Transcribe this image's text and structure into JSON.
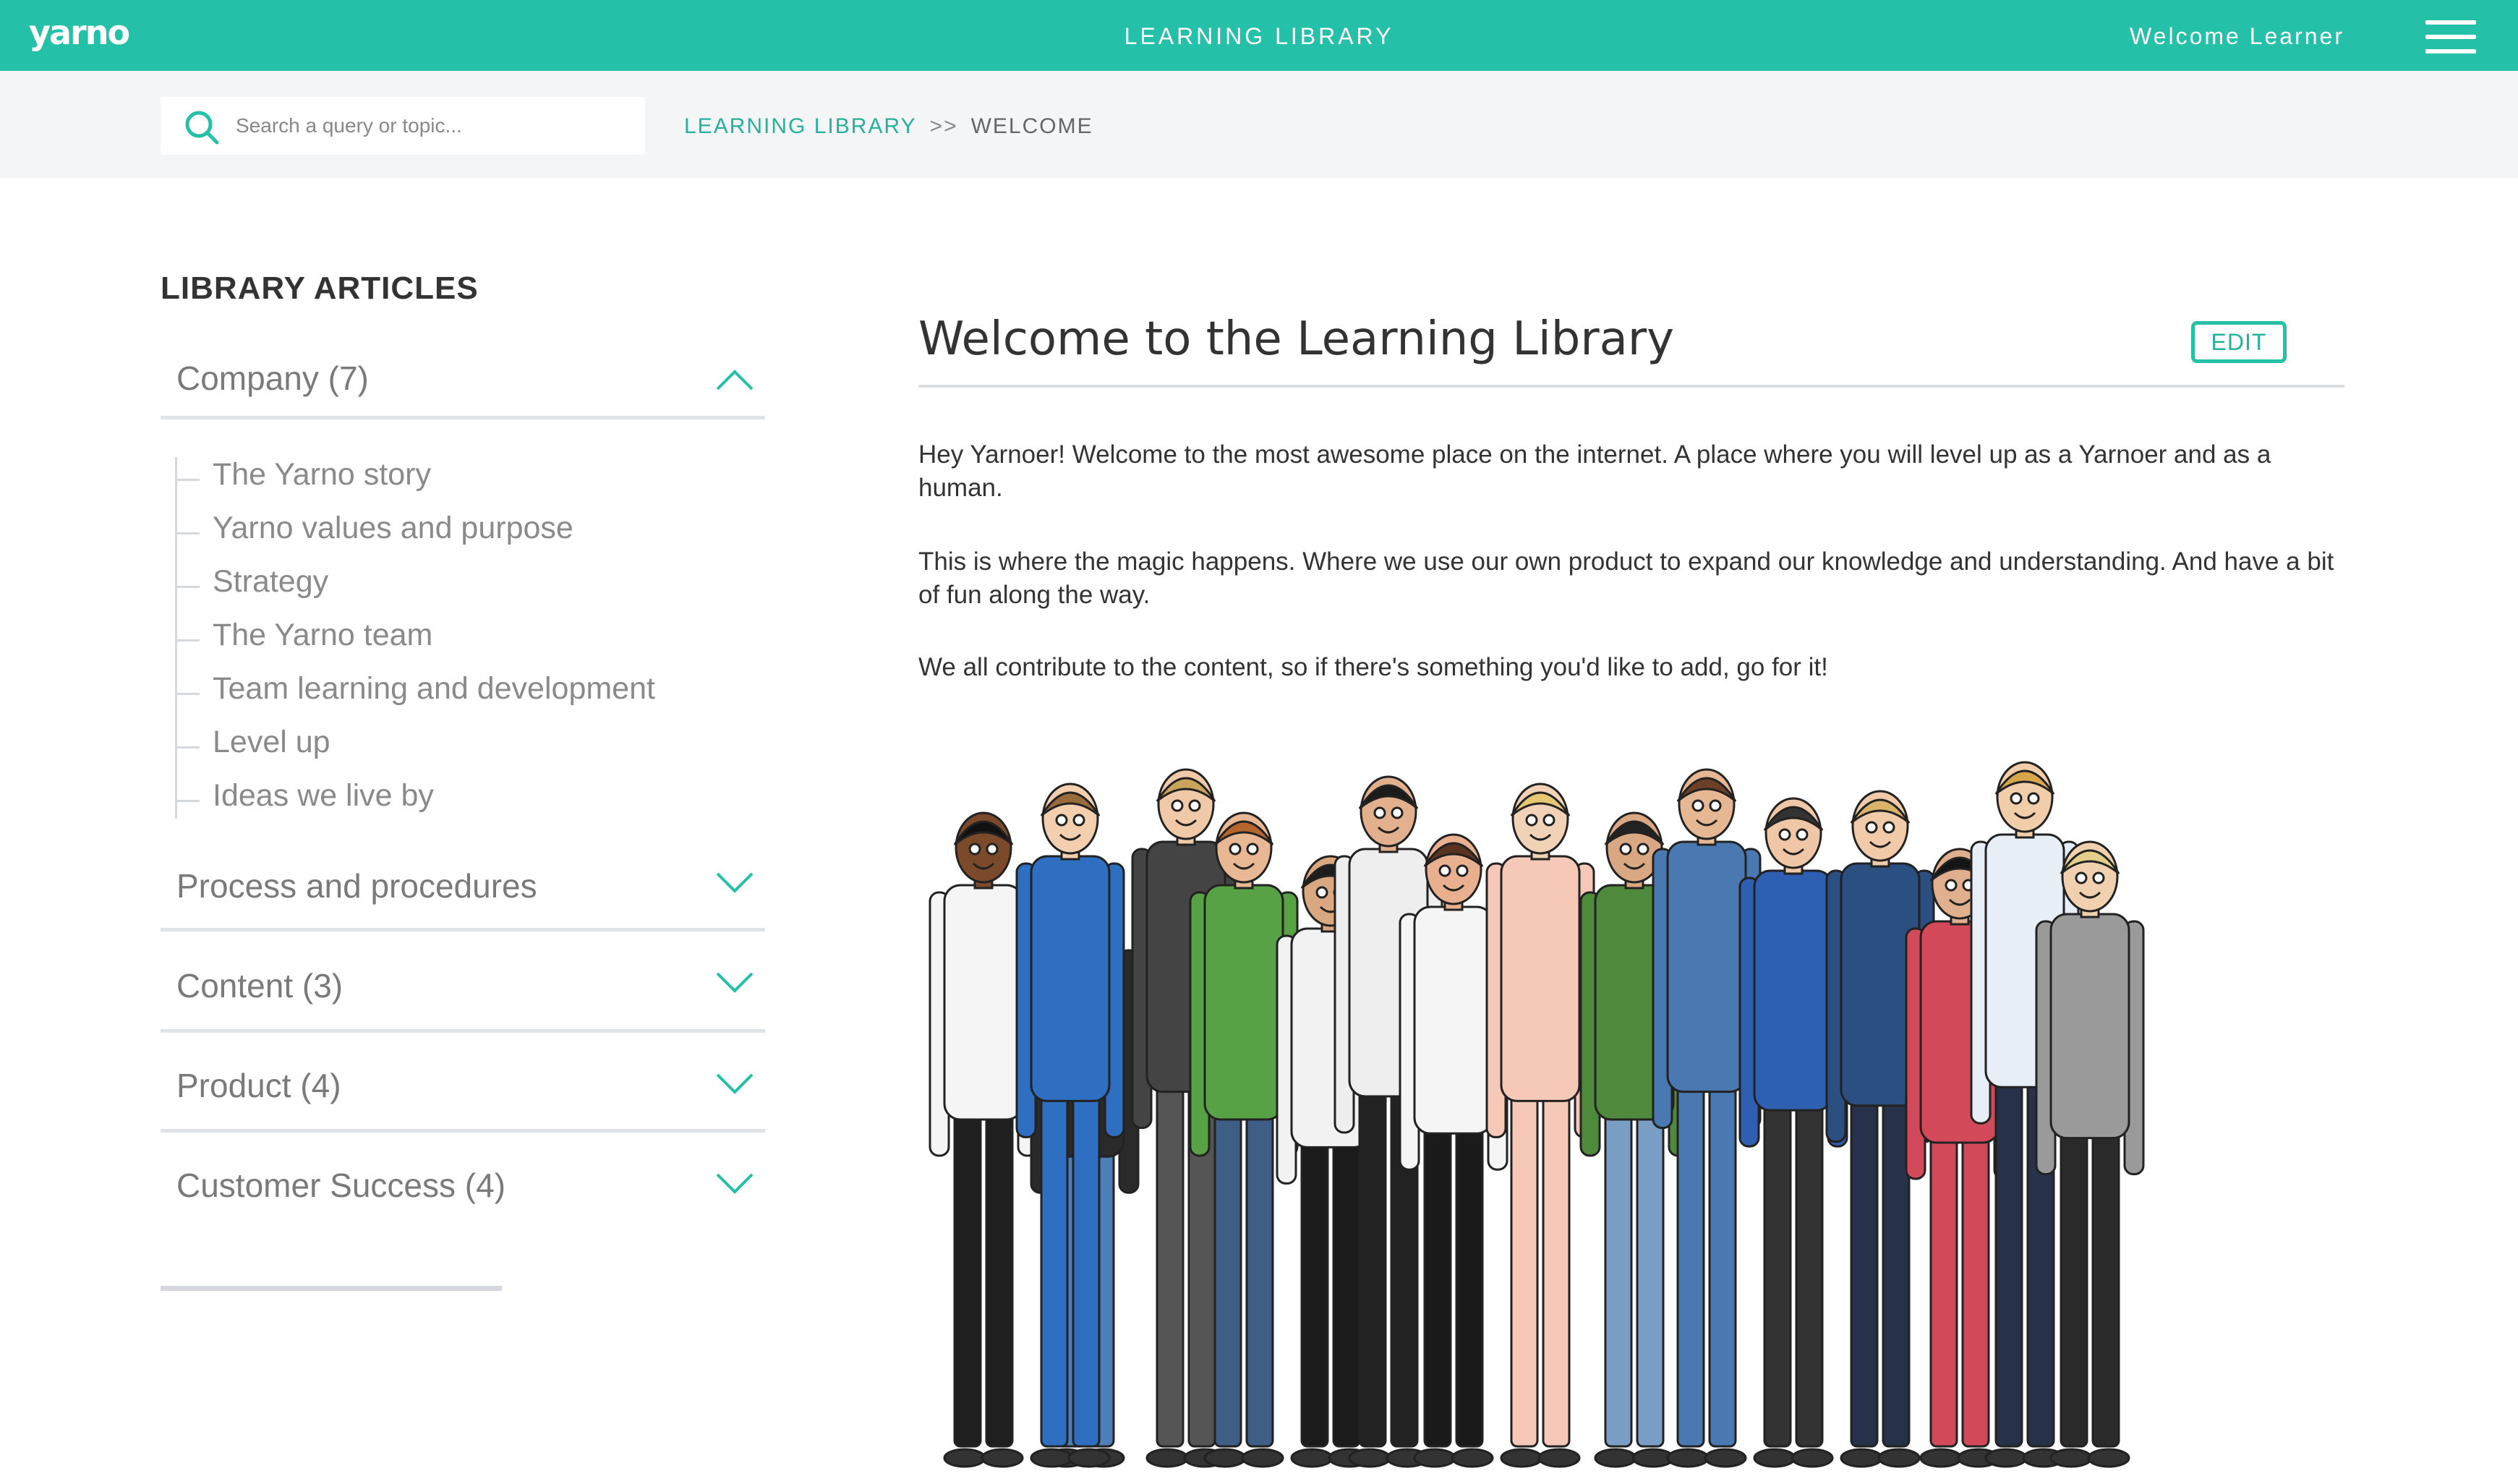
{
  "header": {
    "logo": "yarno",
    "title": "LEARNING LIBRARY",
    "welcome": "Welcome Learner",
    "brand_color": "#25c0a8",
    "menu_icon": "hamburger-menu-icon"
  },
  "search": {
    "placeholder": "Search a query or topic...",
    "icon": "search-icon"
  },
  "breadcrumb": {
    "parent": "LEARNING LIBRARY",
    "separator": ">>",
    "current": "WELCOME"
  },
  "sidebar": {
    "title": "LIBRARY ARTICLES",
    "sections": [
      {
        "label": "Company (7)",
        "expanded": true,
        "items": [
          "The Yarno story",
          "Yarno values and purpose",
          "Strategy",
          "The Yarno team",
          "Team learning and development",
          "Level up",
          "Ideas we live by"
        ]
      },
      {
        "label": "Process and procedures",
        "expanded": false
      },
      {
        "label": "Content (3)",
        "expanded": false
      },
      {
        "label": "Product (4)",
        "expanded": false
      },
      {
        "label": "Customer Success (4)",
        "expanded": false
      }
    ]
  },
  "main": {
    "title": "Welcome to the Learning Library",
    "edit_label": "EDIT",
    "paragraphs": [
      "Hey Yarnoer! Welcome to the most awesome place on the internet. A place where you will level up as a Yarnoer and as a human.",
      "This is where the magic happens. Where we use our own product to expand our knowledge and understanding. And have a bit of fun along the way.",
      "We all contribute to the content, so if there's something you'd like to add, go for it!"
    ]
  }
}
